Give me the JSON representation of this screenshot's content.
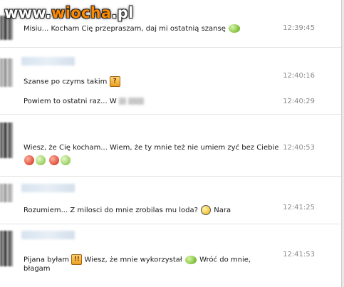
{
  "watermark": {
    "prefix": "www.",
    "brand": "wiocha",
    "suffix": ".pl"
  },
  "messages": [
    {
      "text": "Misiu... Kocham Cię przepraszam, daj mi ostatnią szansę",
      "time": "12:39:45",
      "emoticon": "green-frog-emoticon"
    },
    {
      "text": "Szanse po czyms takim",
      "time": "12:40:16",
      "emoticon": "question-box-emoticon"
    },
    {
      "text": "Powiem to ostatni raz... W",
      "time": "12:40:29",
      "emoticon": ""
    },
    {
      "text": "Wiesz, że Cię kocham... Wiem, że ty mnie też nie umiem zyć bez Ciebie",
      "time": "12:40:53",
      "emoticon": "pair-emoticons"
    },
    {
      "text": "Rozumiem... Z milosci do mnie zrobilas mu loda?",
      "text2": "Nara",
      "time": "12:41:25",
      "emoticon": "smile-emoticon"
    },
    {
      "text": "Pijana byłam",
      "text2": "Wiesz, że mnie wykorzystał",
      "text3": "Wróć do mnie,",
      "text4": "błagam",
      "time": "12:41:53",
      "emoticon": "exclaim-box-emoticon"
    }
  ]
}
